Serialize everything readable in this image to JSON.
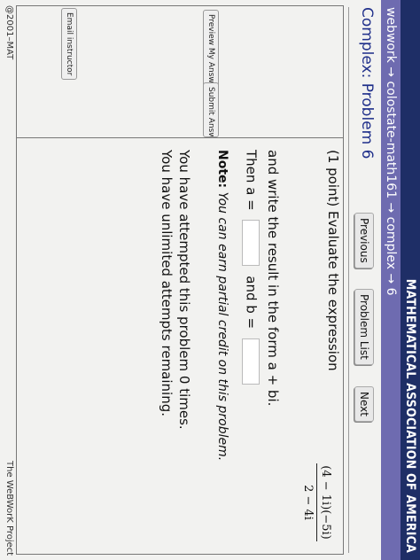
{
  "banner": {
    "text": "MATHEMATICAL ASSOCIATION OF AMERICA"
  },
  "breadcrumb": {
    "parts": [
      "webwork",
      "colostate-math161",
      "complex",
      "6"
    ],
    "separator": "→"
  },
  "title": "Complex: Problem 6",
  "nav": {
    "previous": "Previous",
    "problem_list": "Problem List",
    "next": "Next"
  },
  "sidebar": {
    "preview_label": "Preview My Answers",
    "submit_label": "Submit Answers",
    "email_label": "Email instructor"
  },
  "problem": {
    "prompt": "(1 point) Evaluate the expression",
    "numerator": "(4 − 1i)(−5i)",
    "denominator": "2 − 4i",
    "instruction": "and write the result in the form a + bi.",
    "then_label": "Then a =",
    "and_label": "and b =",
    "a_value": "",
    "b_value": ""
  },
  "note": {
    "label": "Note:",
    "text": "You can earn partial credit on this problem."
  },
  "attempts": {
    "line1": "You have attempted this problem 0 times.",
    "line2": "You have unlimited attempts remaining."
  },
  "footer": {
    "left": "@2001–MAT",
    "right": "The WeBWorK Project"
  },
  "colors": {
    "banner": "#1e2e66",
    "breadcrumb_bar": "#6e6bb0",
    "title": "#1f2f8a"
  }
}
